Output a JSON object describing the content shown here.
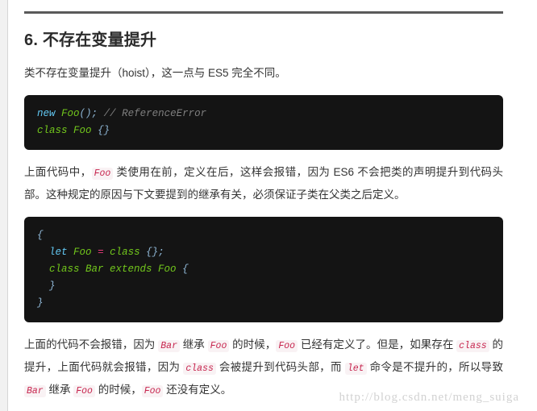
{
  "page": {
    "watermark": "http://blog.csdn.net/meng_suiga",
    "background_color": "#ffffff",
    "gutter_color": "#f1f1f1",
    "rule_color": "#5a5a5a"
  },
  "section": {
    "heading": "6. 不存在变量提升",
    "intro_paragraph": {
      "text": "类不存在变量提升（hoist），这一点与 ES5 完全不同。"
    },
    "code_block_1": {
      "language": "javascript",
      "background_color": "#141414",
      "lines": [
        [
          {
            "text": "new",
            "kind": "keyword",
            "color": "#62c8f3"
          },
          {
            "text": " ",
            "kind": "plain"
          },
          {
            "text": "Foo",
            "kind": "class",
            "color": "#72c71c"
          },
          {
            "text": "();",
            "kind": "punctuation",
            "color": "#8fb7d6"
          },
          {
            "text": " ",
            "kind": "plain"
          },
          {
            "text": "// ReferenceError",
            "kind": "comment",
            "color": "#7f7f7f"
          }
        ],
        [
          {
            "text": "class",
            "kind": "class",
            "color": "#72c71c"
          },
          {
            "text": " ",
            "kind": "plain"
          },
          {
            "text": "Foo",
            "kind": "class",
            "color": "#72c71c"
          },
          {
            "text": " ",
            "kind": "plain"
          },
          {
            "text": "{}",
            "kind": "punctuation",
            "color": "#8fb7d6"
          }
        ]
      ]
    },
    "paragraph_2": {
      "parts": [
        {
          "text": "上面代码中，",
          "kind": "text"
        },
        {
          "text": "Foo",
          "kind": "code"
        },
        {
          "text": " 类使用在前，定义在后，这样会报错，因为 ES6 不会把类的声明提升到代码头部。这种规定的原因与下文要提到的继承有关，必须保证子类在父类之后定义。",
          "kind": "text"
        }
      ]
    },
    "code_block_2": {
      "language": "javascript",
      "background_color": "#141414",
      "lines": [
        [
          {
            "text": "{",
            "kind": "punctuation",
            "color": "#8fb7d6"
          }
        ],
        [
          {
            "text": "  ",
            "kind": "plain"
          },
          {
            "text": "let",
            "kind": "keyword",
            "color": "#62c8f3"
          },
          {
            "text": " ",
            "kind": "plain"
          },
          {
            "text": "Foo",
            "kind": "class",
            "color": "#72c71c"
          },
          {
            "text": " ",
            "kind": "plain"
          },
          {
            "text": "=",
            "kind": "operator",
            "color": "#ef3b7d"
          },
          {
            "text": " ",
            "kind": "plain"
          },
          {
            "text": "class",
            "kind": "class",
            "color": "#72c71c"
          },
          {
            "text": " ",
            "kind": "plain"
          },
          {
            "text": "{};",
            "kind": "punctuation",
            "color": "#8fb7d6"
          }
        ],
        [
          {
            "text": "  ",
            "kind": "plain"
          },
          {
            "text": "class Bar extends Foo",
            "kind": "class",
            "color": "#72c71c"
          },
          {
            "text": " ",
            "kind": "plain"
          },
          {
            "text": "{",
            "kind": "punctuation",
            "color": "#8fb7d6"
          }
        ],
        [
          {
            "text": "  ",
            "kind": "plain"
          },
          {
            "text": "}",
            "kind": "punctuation",
            "color": "#8fb7d6"
          }
        ],
        [
          {
            "text": "}",
            "kind": "punctuation",
            "color": "#8fb7d6"
          }
        ]
      ]
    },
    "paragraph_3": {
      "parts": [
        {
          "text": "上面的代码不会报错，因为 ",
          "kind": "text"
        },
        {
          "text": "Bar",
          "kind": "code"
        },
        {
          "text": " 继承 ",
          "kind": "text"
        },
        {
          "text": "Foo",
          "kind": "code"
        },
        {
          "text": " 的时候，",
          "kind": "text"
        },
        {
          "text": "Foo",
          "kind": "code"
        },
        {
          "text": " 已经有定义了。但是，如果存在 ",
          "kind": "text"
        },
        {
          "text": "class",
          "kind": "code"
        },
        {
          "text": " 的提升，上面代码就会报错，因为 ",
          "kind": "text"
        },
        {
          "text": "class",
          "kind": "code"
        },
        {
          "text": " 会被提升到代码头部，而 ",
          "kind": "text"
        },
        {
          "text": "let",
          "kind": "code"
        },
        {
          "text": " 命令是不提升的，所以导致 ",
          "kind": "text"
        },
        {
          "text": "Bar",
          "kind": "code"
        },
        {
          "text": " 继承 ",
          "kind": "text"
        },
        {
          "text": "Foo",
          "kind": "code"
        },
        {
          "text": " 的时候，",
          "kind": "text"
        },
        {
          "text": "Foo",
          "kind": "code"
        },
        {
          "text": " 还没有定义。",
          "kind": "text"
        }
      ]
    }
  }
}
